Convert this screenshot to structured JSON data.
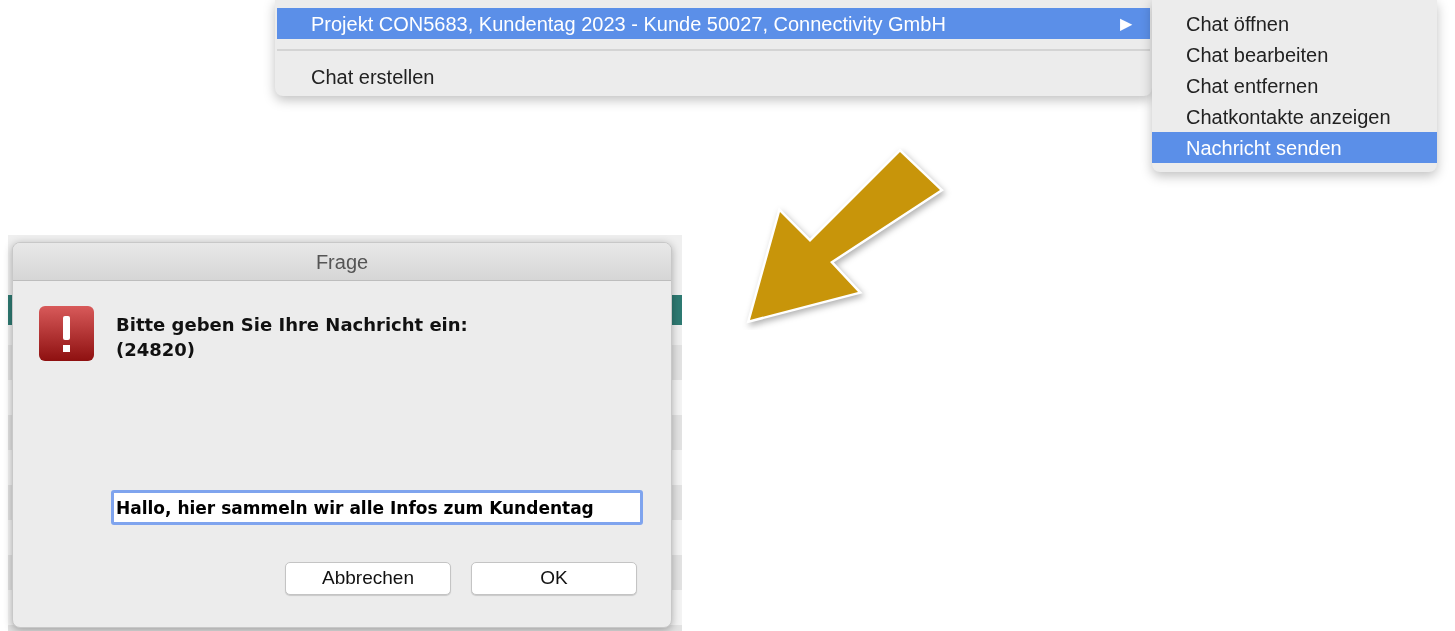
{
  "context_menu": {
    "items": [
      {
        "label": "Projekt CON5683, Kundentag 2023 - Kunde 50027, Connectivity GmbH",
        "selected": true,
        "submenu_arrow": "▶"
      },
      {
        "label": "Chat erstellen",
        "selected": false
      }
    ]
  },
  "submenu": {
    "items": [
      {
        "label": "Chat öffnen",
        "selected": false
      },
      {
        "label": "Chat bearbeiten",
        "selected": false
      },
      {
        "label": "Chat entfernen",
        "selected": false
      },
      {
        "label": "Chatkontakte anzeigen",
        "selected": false
      },
      {
        "label": "Nachricht senden",
        "selected": true
      }
    ]
  },
  "dialog": {
    "title": "Frage",
    "message": [
      "Bitte geben Sie Ihre Nachricht ein:",
      "(24820)"
    ],
    "input": {
      "value": "Hallo, hier sammeln wir alle Infos zum Kundentag"
    },
    "buttons": [
      "Abbrechen",
      "OK"
    ]
  }
}
